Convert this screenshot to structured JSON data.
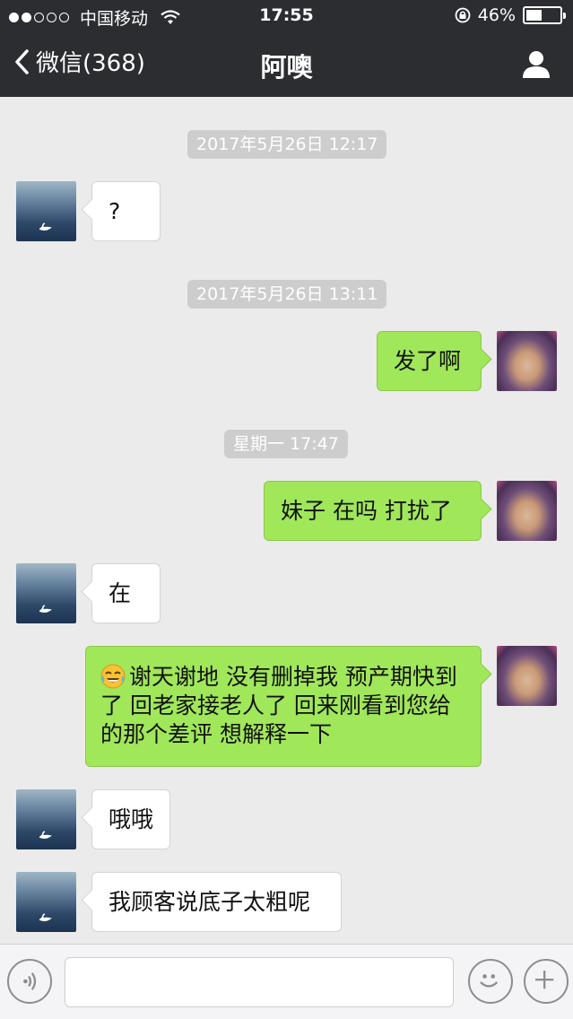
{
  "status_bar": {
    "carrier": "中国移动",
    "time": "17:55",
    "battery": "46%",
    "battery_level": 0.46
  },
  "nav": {
    "back_label": "微信(368)",
    "title": "阿噢"
  },
  "messages": [
    {
      "type": "timestamp",
      "text": "2017年5月26日 12:17"
    },
    {
      "type": "message",
      "from": "other",
      "text": "?"
    },
    {
      "type": "timestamp",
      "text": "2017年5月26日 13:11"
    },
    {
      "type": "message",
      "from": "me",
      "text": "发了啊"
    },
    {
      "type": "timestamp",
      "text": "星期一 17:47"
    },
    {
      "type": "message",
      "from": "me",
      "text": "妹子 在吗 打扰了"
    },
    {
      "type": "message",
      "from": "other",
      "text": "在"
    },
    {
      "type": "message",
      "from": "me",
      "emoji": "tears-of-joy-emoji",
      "text": "谢天谢地 没有删掉我 预产期快到了 回老家接老人了 回来刚看到您给的那个差评 想解释一下"
    },
    {
      "type": "message",
      "from": "other",
      "text": "哦哦"
    },
    {
      "type": "message",
      "from": "other",
      "text": "我顾客说底子太粗呢"
    }
  ],
  "input_bar": {
    "placeholder": ""
  },
  "colors": {
    "header_bg": "#2b2d31",
    "chat_bg": "#ebebeb",
    "my_bubble": "#a0e75a",
    "other_bubble": "#ffffff"
  }
}
